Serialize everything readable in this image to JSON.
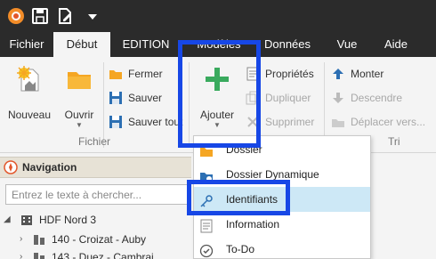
{
  "menu": {
    "tabs": [
      "Fichier",
      "Début",
      "EDITION",
      "Modèles",
      "Données",
      "Vue",
      "Aide"
    ],
    "active_tab": "Début"
  },
  "ribbon": {
    "nouveau": "Nouveau",
    "ouvrir": "Ouvrir",
    "fermer": "Fermer",
    "sauver": "Sauver",
    "sauver_tout": "Sauver tout",
    "ajouter": "Ajouter",
    "proprietes": "Propriétés",
    "dupliquer": "Dupliquer",
    "supprimer": "Supprimer",
    "monter": "Monter",
    "descendre": "Descendre",
    "deplacer": "Déplacer vers...",
    "group_fichier": "Fichier",
    "group_tri": "Tri"
  },
  "navigation": {
    "title": "Navigation",
    "search_placeholder": "Entrez le texte à chercher...",
    "tree": {
      "root": "HDF Nord 3",
      "children": [
        "140 - Croizat - Auby",
        "143 - Duez - Cambrai"
      ]
    }
  },
  "dropdown": {
    "items": [
      "Dossier",
      "Dossier Dynamique",
      "Identifiants",
      "Information",
      "To-Do"
    ],
    "highlighted": "Identifiants"
  },
  "colors": {
    "titlebar": "#2b2b2b",
    "accent_green": "#3aaa5e",
    "highlight_blue": "#1747e6",
    "folder_orange": "#f5a623",
    "selected_item": "#cde8f6"
  }
}
